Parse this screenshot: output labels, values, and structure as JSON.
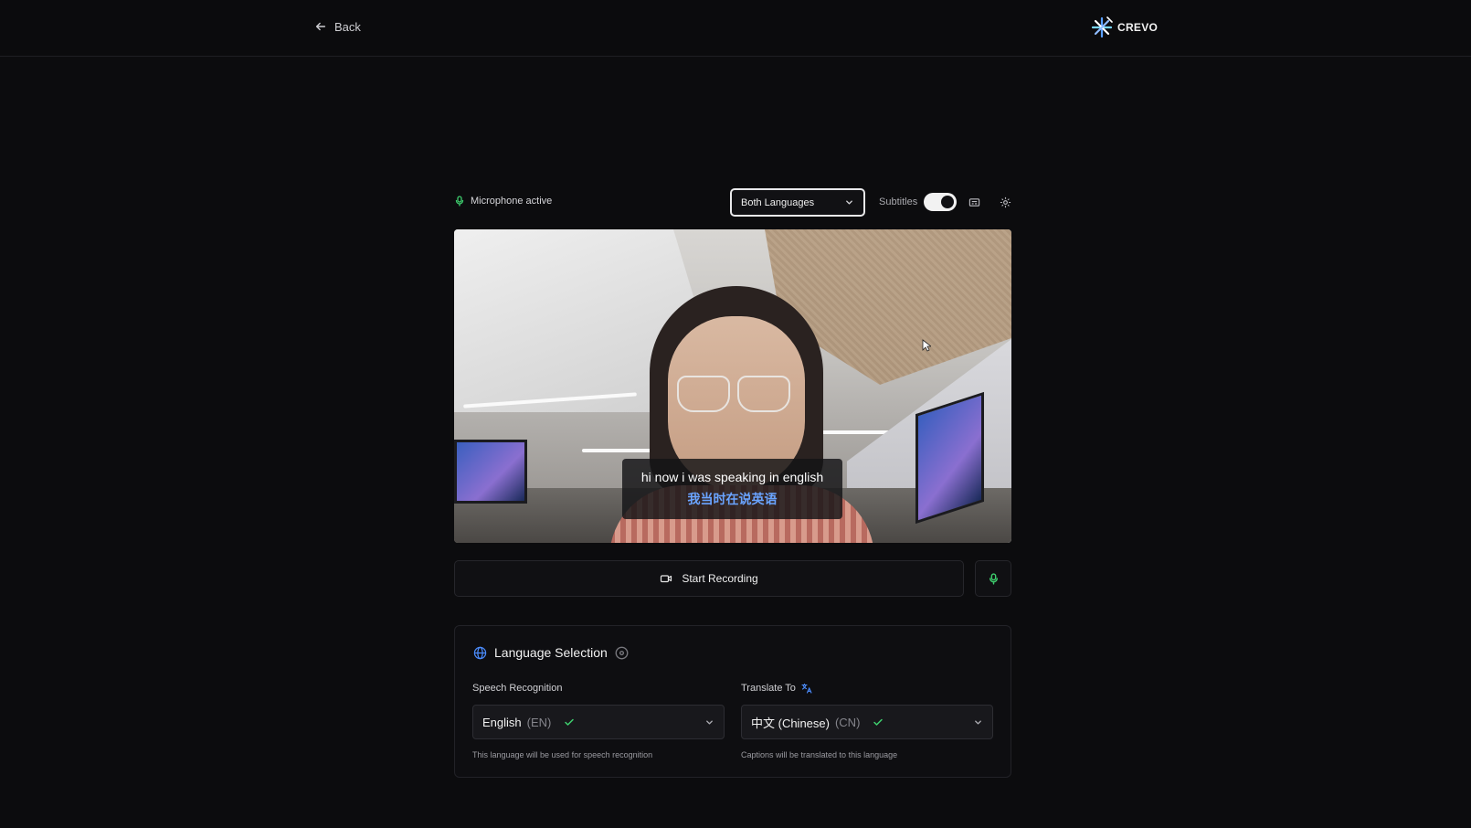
{
  "header": {
    "back_label": "Back",
    "brand_name": "CREVO"
  },
  "controls": {
    "mic_status": "Microphone active",
    "mode_selected": "Both Languages",
    "subtitles_label": "Subtitles",
    "subtitles_on": true
  },
  "video": {
    "caption_original": "hi now i was speaking in english",
    "caption_translated": "我当时在说英语"
  },
  "actions": {
    "record_label": "Start Recording"
  },
  "language_panel": {
    "title": "Language Selection",
    "speech": {
      "label": "Speech Recognition",
      "value": "English",
      "code": "(EN)",
      "hint": "This language will be used for speech recognition"
    },
    "translate": {
      "label": "Translate To",
      "value": "中文 (Chinese)",
      "code": "(CN)",
      "hint": "Captions will be translated to this language"
    }
  },
  "colors": {
    "accent_green": "#3ecf6e",
    "accent_blue": "#4c8dff",
    "background": "#0c0c0e"
  }
}
